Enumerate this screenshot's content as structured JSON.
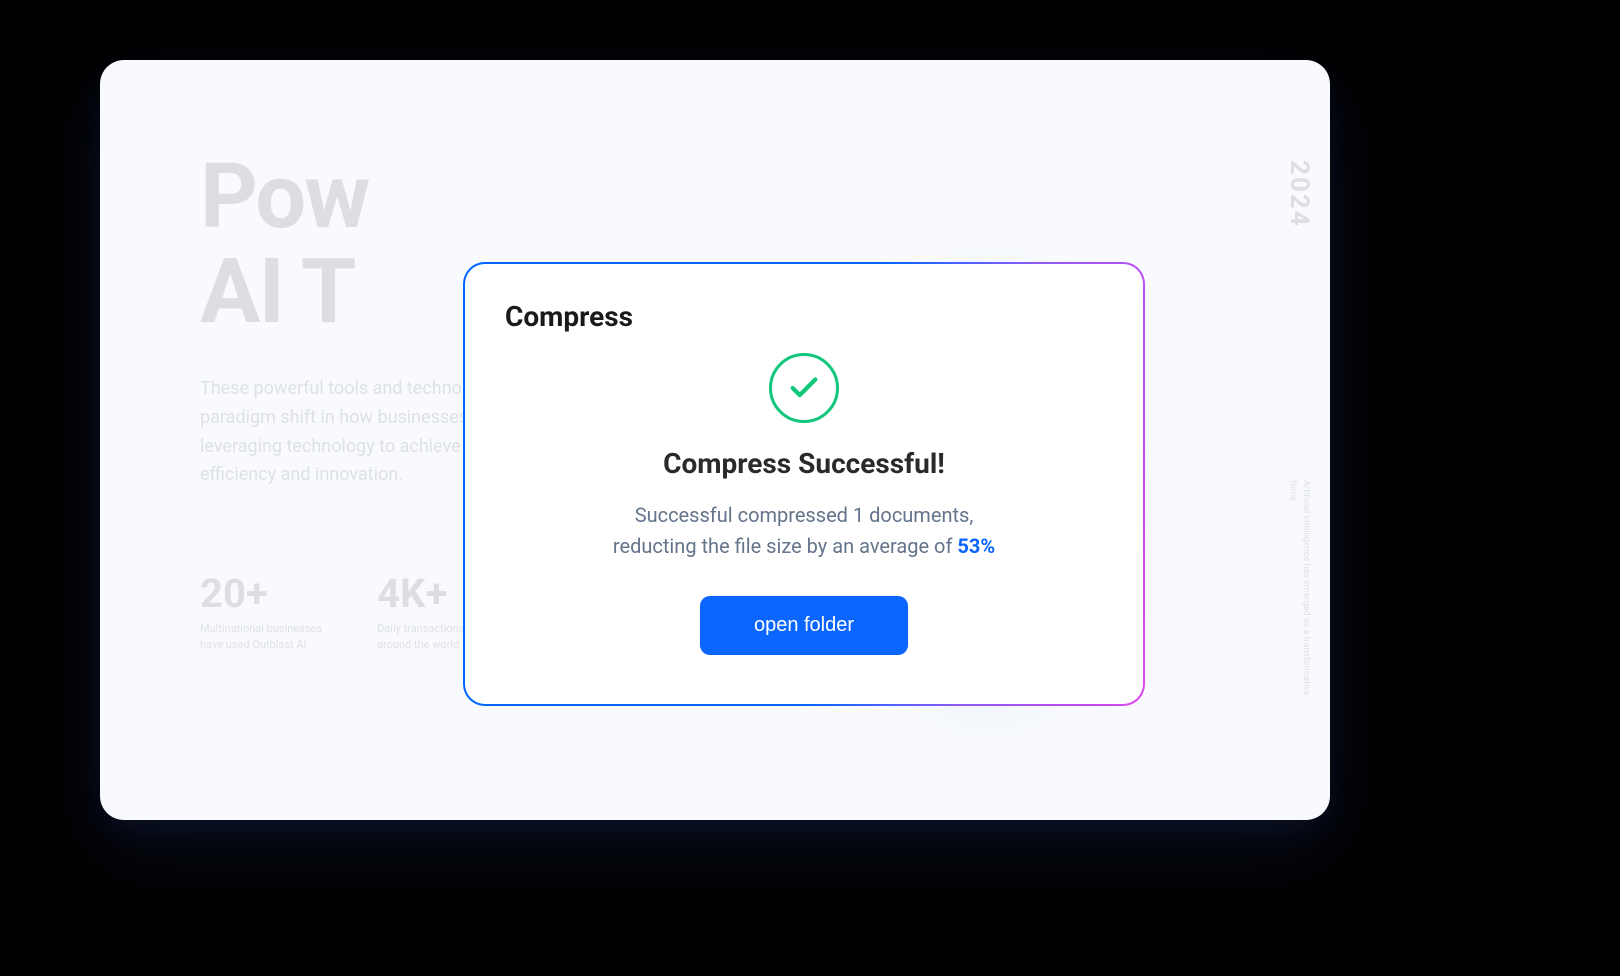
{
  "background": {
    "title_line1": "Pow",
    "title_line2": "AI T",
    "subtitle": "These powerful tools and technologies have catalyzed a paradigm shift in how businesses approach production, leveraging technology to achieve unprecedented levels of efficiency and innovation.",
    "year": "2024",
    "sidetext": "Artificial intelligence has emerged as a transformative force.",
    "stats": [
      {
        "value": "20+",
        "label_line1": "Multinational businesses",
        "label_line2": "have used Outblast AI"
      },
      {
        "value": "4K+",
        "label_line1": "Daily transactions from",
        "label_line2": "around the world"
      }
    ]
  },
  "modal": {
    "title": "Compress",
    "heading": "Compress Successful!",
    "body_line1": "Successful compressed 1 documents,",
    "body_line2_prefix": "reducting the file size by an average of ",
    "percent": "53%",
    "button_label": "open folder"
  }
}
